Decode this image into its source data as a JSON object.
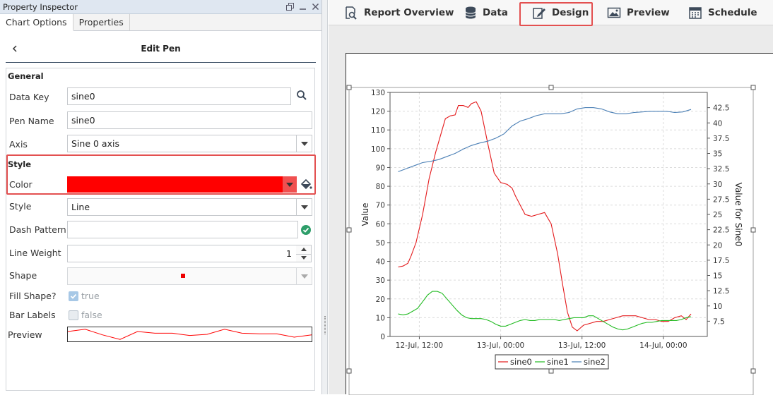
{
  "inspector": {
    "title": "Property Inspector",
    "tabs": [
      {
        "label": "Chart Options",
        "active": true
      },
      {
        "label": "Properties",
        "active": false
      }
    ],
    "edit_pen_title": "Edit Pen",
    "general_header": "General",
    "style_header": "Style",
    "fields": {
      "data_key_label": "Data Key",
      "data_key_value": "sine0",
      "pen_name_label": "Pen Name",
      "pen_name_value": "sine0",
      "axis_label": "Axis",
      "axis_value": "Sine 0 axis",
      "color_label": "Color",
      "color_value": "#ff0000",
      "style_label": "Style",
      "style_value": "Line",
      "dash_label": "Dash Pattern",
      "dash_value": "",
      "weight_label": "Line Weight",
      "weight_value": "1",
      "shape_label": "Shape",
      "fill_label": "Fill Shape?",
      "fill_value": "true",
      "fill_checked": true,
      "bar_labels_label": "Bar Labels",
      "bar_labels_value": "false",
      "bar_labels_checked": false,
      "preview_label": "Preview"
    },
    "preview_line": [
      0.25,
      0.05,
      0.55,
      0.95,
      0.25,
      0.4,
      0.4,
      0.6,
      0.5,
      0.05,
      0.4,
      0.45,
      0.45,
      0.75,
      0.55
    ],
    "icons": [
      "window-restore-icon",
      "minimize-icon",
      "close-icon",
      "back-chevron-icon",
      "search-icon",
      "paint-bucket-icon",
      "valid-check-icon"
    ]
  },
  "toolbar": {
    "items": [
      {
        "label": "Report Overview",
        "icon": "report-search-icon"
      },
      {
        "label": "Data",
        "icon": "database-icon"
      },
      {
        "label": "Design",
        "icon": "design-pencil-icon",
        "active": true
      },
      {
        "label": "Preview",
        "icon": "image-icon"
      },
      {
        "label": "Schedule",
        "icon": "calendar-icon"
      }
    ]
  },
  "chart_data": {
    "type": "line",
    "xlabel": "",
    "ylabel": "Value",
    "y2label": "Value for Sine0",
    "ylim": [
      0,
      130
    ],
    "y2lim": [
      5,
      45
    ],
    "yticks": [
      "0",
      "10",
      "20",
      "30",
      "40",
      "50",
      "60",
      "70",
      "80",
      "90",
      "100",
      "110",
      "120",
      "130"
    ],
    "y2ticks": [
      "7.5",
      "10",
      "12.5",
      "15",
      "17.5",
      "20",
      "22.5",
      "25",
      "27.5",
      "30",
      "32.5",
      "35",
      "37.5",
      "40",
      "42.5"
    ],
    "xticks": [
      "12-Jul, 12:00",
      "13-Jul, 00:00",
      "13-Jul, 12:00",
      "14-Jul, 00:00"
    ],
    "xtick_positions": [
      0.5,
      1.0,
      1.5,
      2.0
    ],
    "xlim": [
      0.32,
      2.27
    ],
    "grid": true,
    "legend_position": "bottom",
    "series": [
      {
        "name": "sine0",
        "color": "#e41a1c",
        "axis": "y",
        "x": [
          0.37,
          0.4,
          0.43,
          0.45,
          0.48,
          0.52,
          0.56,
          0.6,
          0.62,
          0.64,
          0.66,
          0.69,
          0.72,
          0.74,
          0.77,
          0.8,
          0.82,
          0.85,
          0.88,
          0.92,
          0.96,
          1.0,
          1.04,
          1.07,
          1.09,
          1.12,
          1.15,
          1.19,
          1.23,
          1.27,
          1.31,
          1.35,
          1.38,
          1.41,
          1.44,
          1.47,
          1.51,
          1.55,
          1.59,
          1.63,
          1.67,
          1.71,
          1.75,
          1.79,
          1.83,
          1.87,
          1.91,
          1.95,
          1.99,
          2.03,
          2.07,
          2.11,
          2.14,
          2.17
        ],
        "y": [
          37,
          37.5,
          39,
          43,
          50,
          65,
          84,
          98,
          104,
          110,
          116,
          117.5,
          118,
          123,
          123,
          122,
          124,
          125,
          120,
          103,
          87,
          82,
          81,
          79,
          75,
          70,
          65,
          64,
          65,
          66,
          60,
          44,
          28,
          13,
          5,
          3,
          6,
          7,
          8,
          8,
          9,
          10,
          11,
          11,
          11,
          10,
          9,
          9,
          8,
          8,
          10,
          11,
          9,
          12
        ]
      },
      {
        "name": "sine1",
        "color": "#22bb22",
        "axis": "y",
        "x": [
          0.37,
          0.4,
          0.43,
          0.46,
          0.49,
          0.52,
          0.55,
          0.58,
          0.61,
          0.64,
          0.67,
          0.7,
          0.73,
          0.76,
          0.79,
          0.82,
          0.85,
          0.88,
          0.91,
          0.94,
          0.97,
          1.0,
          1.03,
          1.06,
          1.09,
          1.12,
          1.15,
          1.18,
          1.21,
          1.24,
          1.27,
          1.3,
          1.33,
          1.36,
          1.39,
          1.42,
          1.45,
          1.48,
          1.51,
          1.54,
          1.57,
          1.6,
          1.63,
          1.66,
          1.69,
          1.72,
          1.75,
          1.78,
          1.81,
          1.84,
          1.87,
          1.9,
          1.93,
          1.96,
          1.99,
          2.02,
          2.05,
          2.08,
          2.11,
          2.14,
          2.17
        ],
        "y": [
          12,
          11.5,
          12,
          13.5,
          15,
          18.5,
          22,
          24,
          24,
          23,
          20,
          17,
          14,
          11.5,
          10,
          9.5,
          9.5,
          9.5,
          9,
          8,
          6.5,
          5.5,
          5.5,
          6.5,
          7.5,
          8.5,
          9,
          8.5,
          8.5,
          9,
          9,
          9,
          9,
          8.5,
          9,
          9.5,
          10,
          10,
          10,
          11,
          11,
          9.5,
          8,
          6.5,
          5,
          4,
          3.5,
          4,
          5,
          6,
          7,
          7.5,
          7.5,
          8,
          8.5,
          8.5,
          8.5,
          8.5,
          9,
          10,
          10.5
        ]
      },
      {
        "name": "sine2",
        "color": "#4a7fb5",
        "axis": "y2",
        "x": [
          0.37,
          0.42,
          0.47,
          0.52,
          0.57,
          0.62,
          0.67,
          0.72,
          0.77,
          0.82,
          0.87,
          0.92,
          0.97,
          1.02,
          1.07,
          1.12,
          1.17,
          1.22,
          1.27,
          1.32,
          1.37,
          1.42,
          1.47,
          1.52,
          1.57,
          1.62,
          1.67,
          1.72,
          1.77,
          1.82,
          1.87,
          1.92,
          1.97,
          2.02,
          2.07,
          2.12,
          2.17
        ],
        "y": [
          32,
          32.5,
          33,
          33.5,
          33.7,
          34,
          34.5,
          35,
          35.7,
          36.3,
          36.7,
          37,
          37.5,
          38.2,
          39.5,
          40.3,
          40.7,
          41.2,
          41.5,
          41.5,
          41.5,
          41.7,
          42.3,
          42.5,
          42.5,
          42.3,
          41.8,
          41.5,
          41.5,
          41.7,
          41.8,
          41.9,
          41.9,
          41.9,
          41.7,
          41.8,
          42.2
        ]
      }
    ]
  }
}
